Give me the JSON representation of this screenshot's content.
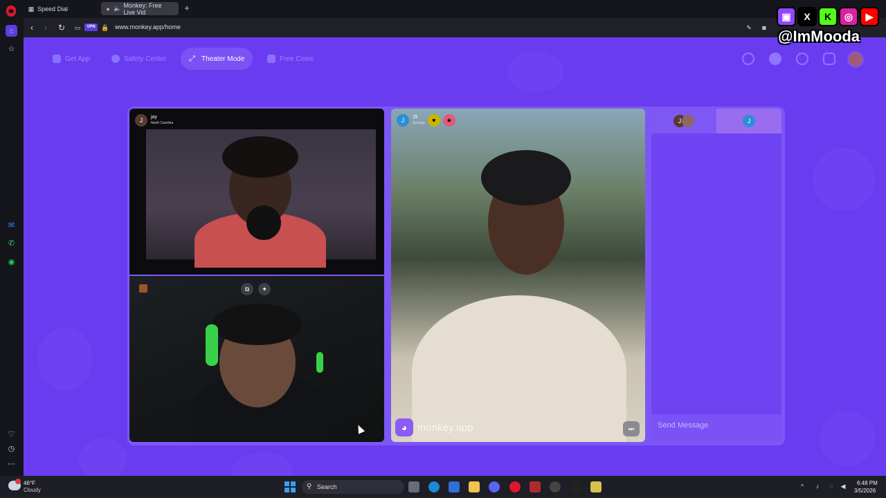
{
  "browser": {
    "tabs": [
      {
        "label": "Speed Dial",
        "icon": "grid-icon"
      },
      {
        "label": "Monkey: Free Live Vid",
        "icon": "monkey-favicon"
      }
    ],
    "url": "www.monkey.app/home",
    "vpn_label": "VPN"
  },
  "header": {
    "menu": [
      {
        "label": "Get App"
      },
      {
        "label": "Safety Center"
      },
      {
        "label": "Theater Mode",
        "active": true
      },
      {
        "label": "Free Coins"
      }
    ]
  },
  "videos": {
    "top_left": {
      "initial": "J",
      "name": "jay",
      "location": "North Carolina"
    },
    "right": {
      "initial": "J",
      "name": "J5",
      "location": "Georgia",
      "brand": "monkey.app"
    }
  },
  "chat": {
    "tab1_initial": "J",
    "tab2_initial": "J",
    "placeholder": "Send Message"
  },
  "taskbar": {
    "temp": "46°F",
    "condition": "Cloudy",
    "search_label": "Search",
    "time": "6:48 PM",
    "date": "3/5/2026"
  },
  "overlay": {
    "handle": "@ImMooda",
    "icons": [
      "twitch-icon",
      "x-icon",
      "kick-icon",
      "instagram-icon",
      "youtube-icon"
    ]
  },
  "colors": {
    "page_bg": "#6a3cf0",
    "accent": "#7a52f5"
  }
}
